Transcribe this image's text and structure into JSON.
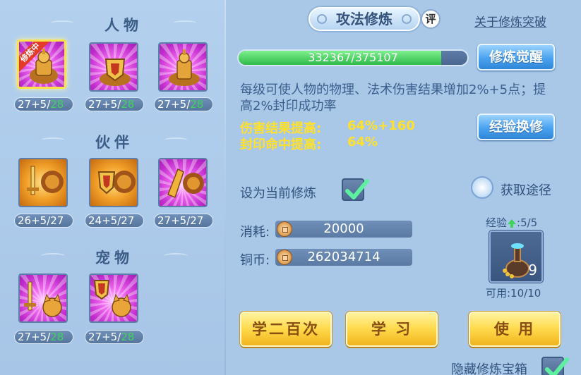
{
  "left": {
    "sections": {
      "character": "人物",
      "partner": "伙伴",
      "pet": "宠物"
    },
    "character_slots": [
      {
        "tag": "修炼中",
        "level": "27+5/",
        "level_green": "28"
      },
      {
        "level": "27+5/",
        "level_green": "28"
      },
      {
        "level": "27+5/",
        "level_green": "28"
      }
    ],
    "partner_slots": [
      {
        "level": "26+5/27"
      },
      {
        "level": "24+5/27"
      },
      {
        "level": "27+5/27"
      }
    ],
    "pet_slots": [
      {
        "level": "27+5/",
        "level_green": "28"
      },
      {
        "level": "27+5/",
        "level_green": "28"
      }
    ]
  },
  "header": {
    "title": "攻法修炼",
    "rate_badge": "评",
    "about_link": "关于修炼突破"
  },
  "progress": {
    "text": "332367/375107",
    "current": 332367,
    "max": 375107
  },
  "buttons": {
    "awaken": "修炼觉醒",
    "exchange": "经验换修",
    "learn_200": "学二百次",
    "learn": "学 习",
    "use": "使 用"
  },
  "description": "每级可使人物的物理、法术伤害结果增加2%+5点；提高2%封印成功率",
  "effects": [
    {
      "label": "伤害结果提高:",
      "value": "64%+160"
    },
    {
      "label": "封印命中提高:",
      "value": "64%"
    }
  ],
  "set_current": {
    "label": "设为当前修炼",
    "checked": true
  },
  "get_path": "获取途径",
  "cost": {
    "label": "消耗:",
    "value": "20000"
  },
  "coins": {
    "label": "铜币:",
    "value": "262034714"
  },
  "item": {
    "exp_label": "经验",
    "exp_count": ":5/5",
    "count": "9",
    "usable": "可用:10/10"
  },
  "hide_chest": {
    "label": "隐藏修炼宝箱",
    "checked": true
  },
  "colors": {
    "background": "#a9c8e8",
    "accent_yellow": "#ffe02a",
    "text_blue": "#3b5f8c",
    "progress_green": "#2fba4a"
  }
}
